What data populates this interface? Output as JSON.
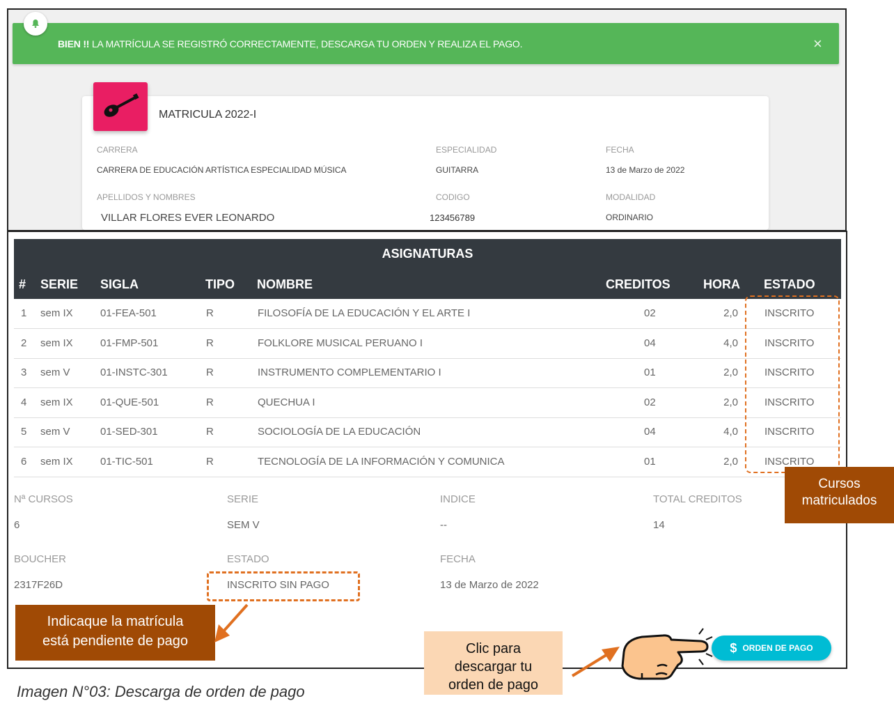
{
  "alert": {
    "strong": "BIEN !!",
    "message": " LA MATRÍCULA SE REGISTRÓ CORRECTAMENTE, DESCARGA TU ORDEN Y REALIZA EL PAGO.",
    "close": "×"
  },
  "card": {
    "title": "MATRICULA 2022-I",
    "carrera_label": "CARRERA",
    "carrera_value": "CARRERA DE EDUCACIÓN ARTÍSTICA ESPECIALIDAD MÚSICA",
    "especialidad_label": "ESPECIALIDAD",
    "especialidad_value": "GUITARRA",
    "fecha_label": "FECHA",
    "fecha_value": "13 de Marzo de 2022",
    "apellidos_label": "APELLIDOS Y NOMBRES",
    "apellidos_value": "VILLAR FLORES EVER LEONARDO",
    "codigo_label": "CODIGO",
    "codigo_value": "123456789",
    "modalidad_label": "MODALIDAD",
    "modalidad_value": "ORDINARIO"
  },
  "table": {
    "title": "ASIGNATURAS",
    "headers": [
      "#",
      "SERIE",
      "SIGLA",
      "TIPO",
      "NOMBRE",
      "CREDITOS",
      "HORA",
      "ESTADO"
    ],
    "rows": [
      [
        "1",
        "sem IX",
        "01-FEA-501",
        "R",
        "FILOSOFÍA DE LA EDUCACIÓN Y EL ARTE I",
        "02",
        "2,0",
        "INSCRITO"
      ],
      [
        "2",
        "sem IX",
        "01-FMP-501",
        "R",
        "FOLKLORE MUSICAL PERUANO I",
        "04",
        "4,0",
        "INSCRITO"
      ],
      [
        "3",
        "sem V",
        "01-INSTC-301",
        "R",
        "INSTRUMENTO COMPLEMENTARIO I",
        "01",
        "2,0",
        "INSCRITO"
      ],
      [
        "4",
        "sem IX",
        "01-QUE-501",
        "R",
        "QUECHUA I",
        "02",
        "2,0",
        "INSCRITO"
      ],
      [
        "5",
        "sem V",
        "01-SED-301",
        "R",
        "SOCIOLOGÍA DE LA EDUCACIÓN",
        "04",
        "4,0",
        "INSCRITO"
      ],
      [
        "6",
        "sem IX",
        "01-TIC-501",
        "R",
        "TECNOLOGÍA DE LA INFORMACIÓN Y COMUNICA",
        "01",
        "2,0",
        "INSCRITO"
      ]
    ]
  },
  "summary": {
    "cursos_label": "Nª CURSOS",
    "cursos_value": "6",
    "serie_label": "SERIE",
    "serie_value": "SEM V",
    "indice_label": "INDICE",
    "indice_value": "--",
    "total_label": "TOTAL CREDITOS",
    "total_value": "14",
    "boucher_label": "BOUCHER",
    "boucher_value": "2317F26D",
    "estado_label": "ESTADO",
    "estado_value": "INSCRITO SIN PAGO",
    "fecha_label": "FECHA",
    "fecha_value": "13 de Marzo de 2022"
  },
  "annotations": {
    "cursos_line1": "Cursos",
    "cursos_line2": "matriculados",
    "pendiente_line1": "Indicaque la matrícula",
    "pendiente_line2": "está pendiente de pago",
    "clic_line1": "Clic para",
    "clic_line2": "descargar tu",
    "clic_line3": "orden de pago"
  },
  "pay_button": {
    "icon": "$",
    "label": "ORDEN DE PAGO"
  },
  "caption": "Imagen N°03: Descarga de orden  de pago",
  "colors": {
    "alert_green": "#55b658",
    "table_header": "#343a40",
    "annotation_brown": "#a04a05",
    "annotation_peach": "#fbd7b4",
    "dash_orange": "#e07020",
    "pay_button": "#00bcd4",
    "icon_pink": "#e91e63"
  }
}
